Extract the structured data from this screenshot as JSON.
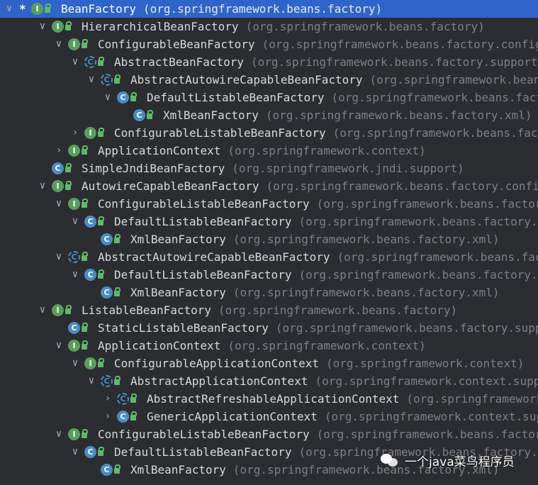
{
  "tree": [
    {
      "depth": 0,
      "arrow": "down",
      "star": "*",
      "icon": "I",
      "name": "BeanFactory",
      "pkg": "(org.springframework.beans.factory)",
      "selected": true
    },
    {
      "depth": 1,
      "arrow": "down",
      "icon": "I",
      "name": "HierarchicalBeanFactory",
      "pkg": "(org.springframework.beans.factory)"
    },
    {
      "depth": 2,
      "arrow": "down",
      "icon": "I",
      "name": "ConfigurableBeanFactory",
      "pkg": "(org.springframework.beans.factory.config)"
    },
    {
      "depth": 3,
      "arrow": "down",
      "icon": "AC",
      "name": "AbstractBeanFactory",
      "pkg": "(org.springframework.beans.factory.support)"
    },
    {
      "depth": 4,
      "arrow": "down",
      "icon": "AC",
      "name": "AbstractAutowireCapableBeanFactory",
      "pkg": "(org.springframework.beans.factory.support)"
    },
    {
      "depth": 5,
      "arrow": "down",
      "icon": "C",
      "name": "DefaultListableBeanFactory",
      "pkg": "(org.springframework.beans.factory.support)"
    },
    {
      "depth": 6,
      "arrow": "",
      "icon": "C",
      "name": "XmlBeanFactory",
      "pkg": "(org.springframework.beans.factory.xml)"
    },
    {
      "depth": 3,
      "arrow": "right",
      "icon": "I",
      "name": "ConfigurableListableBeanFactory",
      "pkg": "(org.springframework.beans.factory.config)"
    },
    {
      "depth": 2,
      "arrow": "right",
      "icon": "I",
      "name": "ApplicationContext",
      "pkg": "(org.springframework.context)"
    },
    {
      "depth": 1,
      "arrow": "",
      "icon": "C",
      "name": "SimpleJndiBeanFactory",
      "pkg": "(org.springframework.jndi.support)"
    },
    {
      "depth": 1,
      "arrow": "down",
      "icon": "I",
      "name": "AutowireCapableBeanFactory",
      "pkg": "(org.springframework.beans.factory.config)"
    },
    {
      "depth": 2,
      "arrow": "down",
      "icon": "I",
      "name": "ConfigurableListableBeanFactory",
      "pkg": "(org.springframework.beans.factory.config)"
    },
    {
      "depth": 3,
      "arrow": "down",
      "icon": "C",
      "name": "DefaultListableBeanFactory",
      "pkg": "(org.springframework.beans.factory.support)"
    },
    {
      "depth": 4,
      "arrow": "",
      "icon": "C",
      "name": "XmlBeanFactory",
      "pkg": "(org.springframework.beans.factory.xml)"
    },
    {
      "depth": 2,
      "arrow": "down",
      "icon": "AC",
      "name": "AbstractAutowireCapableBeanFactory",
      "pkg": "(org.springframework.beans.factory.support)"
    },
    {
      "depth": 3,
      "arrow": "down",
      "icon": "C",
      "name": "DefaultListableBeanFactory",
      "pkg": "(org.springframework.beans.factory.support)"
    },
    {
      "depth": 4,
      "arrow": "",
      "icon": "C",
      "name": "XmlBeanFactory",
      "pkg": "(org.springframework.beans.factory.xml)"
    },
    {
      "depth": 1,
      "arrow": "down",
      "icon": "I",
      "name": "ListableBeanFactory",
      "pkg": "(org.springframework.beans.factory)"
    },
    {
      "depth": 2,
      "arrow": "",
      "icon": "C",
      "name": "StaticListableBeanFactory",
      "pkg": "(org.springframework.beans.factory.support)"
    },
    {
      "depth": 2,
      "arrow": "down",
      "icon": "I",
      "name": "ApplicationContext",
      "pkg": "(org.springframework.context)"
    },
    {
      "depth": 3,
      "arrow": "down",
      "icon": "I",
      "name": "ConfigurableApplicationContext",
      "pkg": "(org.springframework.context)"
    },
    {
      "depth": 4,
      "arrow": "down",
      "icon": "AC",
      "name": "AbstractApplicationContext",
      "pkg": "(org.springframework.context.support)"
    },
    {
      "depth": 5,
      "arrow": "right",
      "icon": "AC",
      "name": "AbstractRefreshableApplicationContext",
      "pkg": "(org.springframework.context.support)"
    },
    {
      "depth": 5,
      "arrow": "right",
      "icon": "C",
      "name": "GenericApplicationContext",
      "pkg": "(org.springframework.context.support)"
    },
    {
      "depth": 2,
      "arrow": "down",
      "icon": "I",
      "name": "ConfigurableListableBeanFactory",
      "pkg": "(org.springframework.beans.factory.config)"
    },
    {
      "depth": 3,
      "arrow": "down",
      "icon": "C",
      "name": "DefaultListableBeanFactory",
      "pkg": "(org.springframework.beans.factory.support)"
    },
    {
      "depth": 4,
      "arrow": "",
      "icon": "C",
      "name": "XmlBeanFactory",
      "pkg": "(org.springframework.beans.factory.xml)"
    }
  ],
  "watermark": {
    "text": "一个java菜鸟程序员"
  }
}
